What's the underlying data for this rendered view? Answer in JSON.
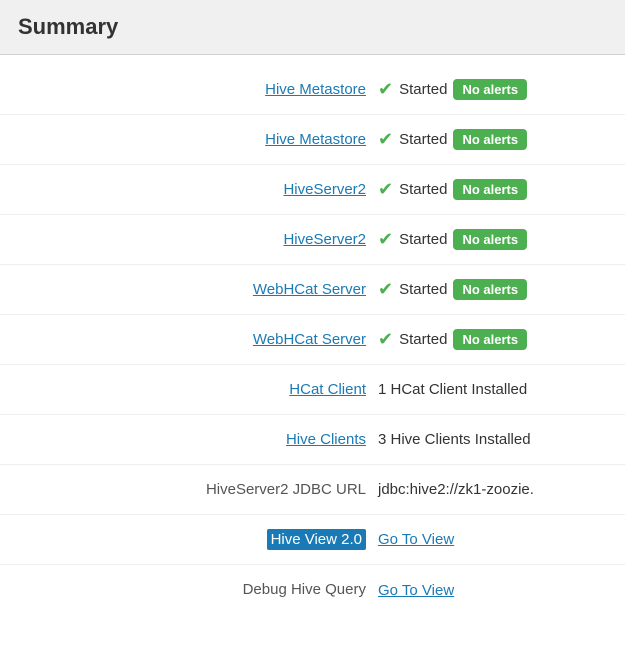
{
  "header": {
    "title": "Summary"
  },
  "rows": [
    {
      "id": "hive-metastore-1",
      "label": "Hive Metastore",
      "label_type": "link",
      "status": "Started",
      "badge": "No alerts",
      "badge_type": "green"
    },
    {
      "id": "hive-metastore-2",
      "label": "Hive Metastore",
      "label_type": "link",
      "status": "Started",
      "badge": "No alerts",
      "badge_type": "green"
    },
    {
      "id": "hiveserver2-1",
      "label": "HiveServer2",
      "label_type": "link",
      "status": "Started",
      "badge": "No alerts",
      "badge_type": "green"
    },
    {
      "id": "hiveserver2-2",
      "label": "HiveServer2",
      "label_type": "link",
      "status": "Started",
      "badge": "No alerts",
      "badge_type": "green"
    },
    {
      "id": "webhcat-server-1",
      "label": "WebHCat Server",
      "label_type": "link",
      "status": "Started",
      "badge": "No alerts",
      "badge_type": "green"
    },
    {
      "id": "webhcat-server-2",
      "label": "WebHCat Server",
      "label_type": "link",
      "status": "Started",
      "badge": "No alerts",
      "badge_type": "green"
    },
    {
      "id": "hcat-client",
      "label": "HCat Client",
      "label_type": "link",
      "status": "1 HCat Client Installed",
      "badge": null,
      "badge_type": null
    },
    {
      "id": "hive-clients",
      "label": "Hive Clients",
      "label_type": "link",
      "status": "3 Hive Clients Installed",
      "badge": null,
      "badge_type": null
    },
    {
      "id": "hiveserver2-jdbc",
      "label": "HiveServer2 JDBC URL",
      "label_type": "text",
      "status": "jdbc:hive2://zk1-zoozie.",
      "badge": null,
      "badge_type": null
    },
    {
      "id": "hive-view-2",
      "label": "Hive View 2.0",
      "label_type": "highlight",
      "status": null,
      "link_text": "Go To View",
      "badge": null,
      "badge_type": null
    },
    {
      "id": "debug-hive-query",
      "label": "Debug Hive Query",
      "label_type": "text",
      "status": null,
      "link_text": "Go To View",
      "badge": null,
      "badge_type": null
    }
  ],
  "icons": {
    "check": "✔"
  }
}
